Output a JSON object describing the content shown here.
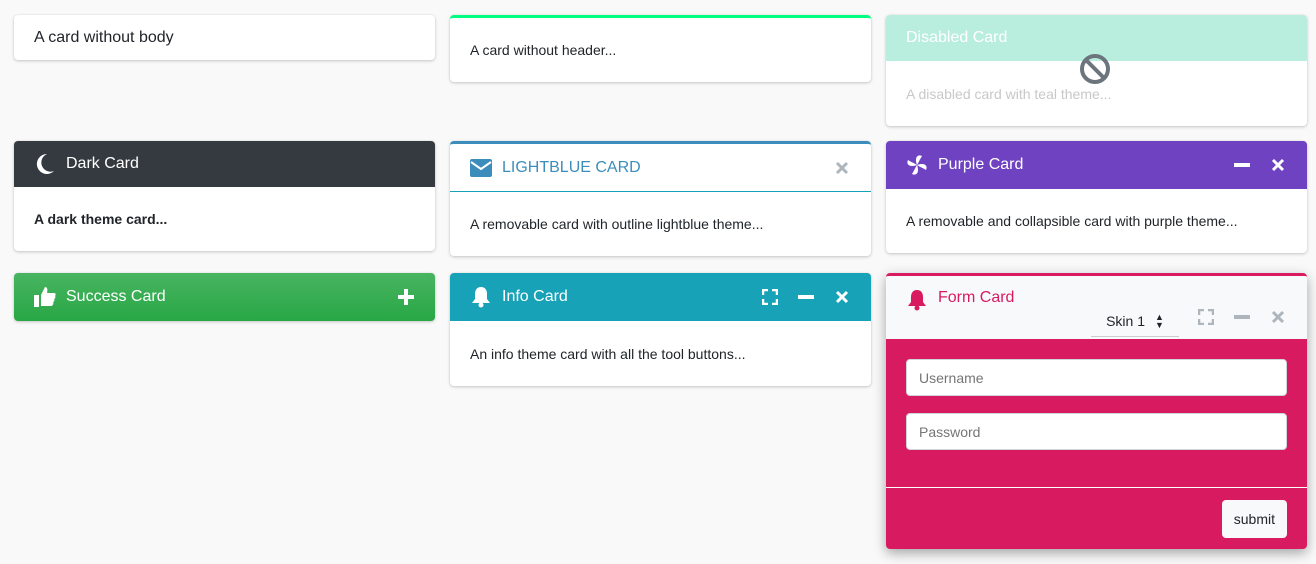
{
  "cards": {
    "no_body": {
      "title": "A card without body"
    },
    "no_header": {
      "text": "A card without header...",
      "accent": "#00ff80"
    },
    "disabled": {
      "title": "Disabled Card",
      "text": "A disabled card with teal theme...",
      "color": "#b9eedf"
    },
    "dark": {
      "title": "Dark Card",
      "text": "A dark theme card...",
      "icon": "moon-icon",
      "color": "#343a40"
    },
    "lightblue": {
      "title": "LIGHTBLUE CARD",
      "text": "A removable card with outline lightblue theme...",
      "icon": "envelope-icon",
      "color": "#3c8dbc"
    },
    "purple": {
      "title": "Purple Card",
      "text": "A removable and collapsible card with purple theme...",
      "icon": "fan-icon",
      "color": "#6f42c1"
    },
    "success": {
      "title": "Success Card",
      "icon": "thumbs-up-icon",
      "color": "#28a745"
    },
    "info": {
      "title": "Info Card",
      "text": "An info theme card with all the tool buttons...",
      "icon": "bell-icon",
      "color": "#17a2b8"
    },
    "form": {
      "title": "Form Card",
      "icon": "bell-icon",
      "color": "#d81b60",
      "skin_select": "Skin 1",
      "username_placeholder": "Username",
      "password_placeholder": "Password",
      "submit": "submit"
    }
  }
}
